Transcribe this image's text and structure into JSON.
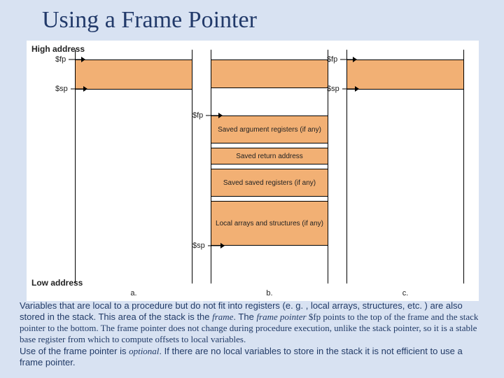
{
  "title": "Using a Frame Pointer",
  "labels": {
    "high": "High address",
    "low": "Low address",
    "fp": "$fp",
    "sp": "$sp",
    "col_a": "a.",
    "col_b": "b.",
    "col_c": "c."
  },
  "segments": {
    "saved_args": "Saved argument registers (if any)",
    "saved_ra": "Saved return address",
    "saved_regs": "Saved saved registers (if any)",
    "locals": "Local arrays and structures (if any)"
  },
  "paragraph": {
    "p1a": "Variables that are local to a procedure but do not fit into registers (e. g. , local arrays, structures, etc. ) are also stored in the stack. This area of the stack is the ",
    "frame": "frame",
    "p1b": ". The ",
    "framepointer": "frame pointer",
    "p1c": " $fp points to the top of the frame and the stack pointer to the bottom. The frame pointer does not change during procedure execution, unlike the stack pointer, so it is a stable base register from which to compute offsets to local variables.",
    "p2a": "Use of the frame pointer is ",
    "optional": "optional",
    "p2b": ". If there are no local variables to store in the stack it is not efficient to use a frame pointer."
  }
}
